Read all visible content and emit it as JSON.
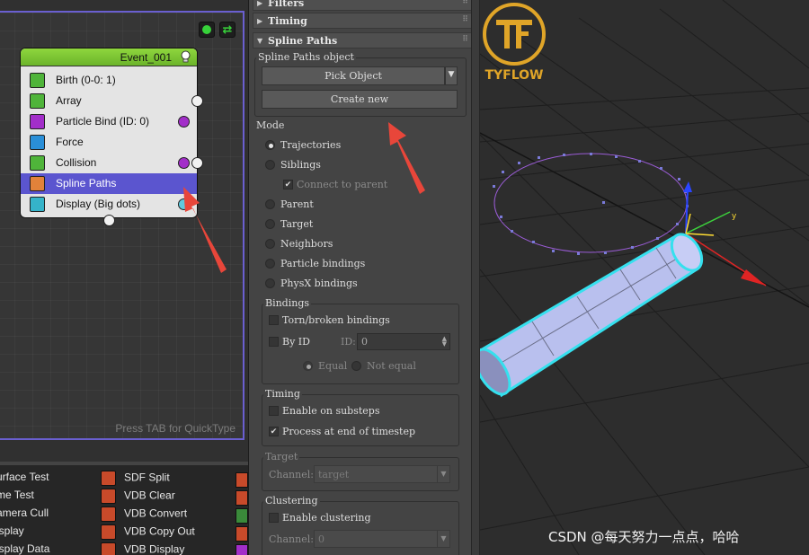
{
  "node_editor": {
    "event": {
      "title": "Event_001",
      "operators": [
        {
          "label": "Birth (0-0: 1)",
          "icon": "birth-icon",
          "color": "#4fb43a"
        },
        {
          "label": "Array",
          "icon": "array-icon",
          "color": "#4fb43a"
        },
        {
          "label": "Particle Bind (ID: 0)",
          "icon": "particle-bind-icon",
          "color": "#a22ec9"
        },
        {
          "label": "Force",
          "icon": "force-icon",
          "color": "#2a8fd8"
        },
        {
          "label": "Collision",
          "icon": "collision-icon",
          "color": "#4fb43a"
        },
        {
          "label": "Spline Paths",
          "icon": "spline-paths-icon",
          "color": "#e2823a"
        },
        {
          "label": "Display (Big dots)",
          "icon": "display-icon",
          "color": "#35b3c9"
        }
      ],
      "selected_index": 5
    },
    "quicktype_hint": "Press TAB for QuickType",
    "accent_color": "#6a5fd0"
  },
  "operator_depot": {
    "col1": [
      "urface Test",
      "me Test",
      "amera Cull",
      "isplay",
      "isplay Data"
    ],
    "col2": [
      "SDF Split",
      "VDB Clear",
      "VDB Convert",
      "VDB Copy Out",
      "VDB Display"
    ]
  },
  "rollouts": {
    "filters": "Filters",
    "timing": "Timing",
    "spline_paths": "Spline Paths"
  },
  "spline_paths": {
    "object_group": "Spline Paths object",
    "pick_object": "Pick Object",
    "create_new": "Create new",
    "mode": {
      "label": "Mode",
      "options": [
        "Trajectories",
        "Siblings",
        "Parent",
        "Target",
        "Neighbors",
        "Particle bindings",
        "PhysX bindings"
      ],
      "selected": "Trajectories",
      "connect_to_parent": "Connect to parent"
    },
    "bindings": {
      "label": "Bindings",
      "torn": "Torn/broken bindings",
      "by_id": "By ID",
      "id_label": "ID:",
      "id_value": "0",
      "equal": "Equal",
      "not_equal": "Not equal"
    },
    "timing": {
      "label": "Timing",
      "enable_substeps": "Enable on substeps",
      "process_end": "Process at end of timestep"
    },
    "target": {
      "label": "Target",
      "channel_label": "Channel:",
      "channel_value": "target"
    },
    "clustering": {
      "label": "Clustering",
      "enable": "Enable clustering",
      "channel_label": "Channel:",
      "channel_value": "0"
    }
  },
  "watermark": "CSDN @每天努力一点点，哈哈",
  "logo_text": "TYFLOW",
  "colors": {
    "arrow": "#e8463a",
    "cylinder": "#b9c0ee",
    "cylinder_outline": "#35e0ee",
    "spline": "#9a5cd6",
    "logo": "#e0a528"
  }
}
